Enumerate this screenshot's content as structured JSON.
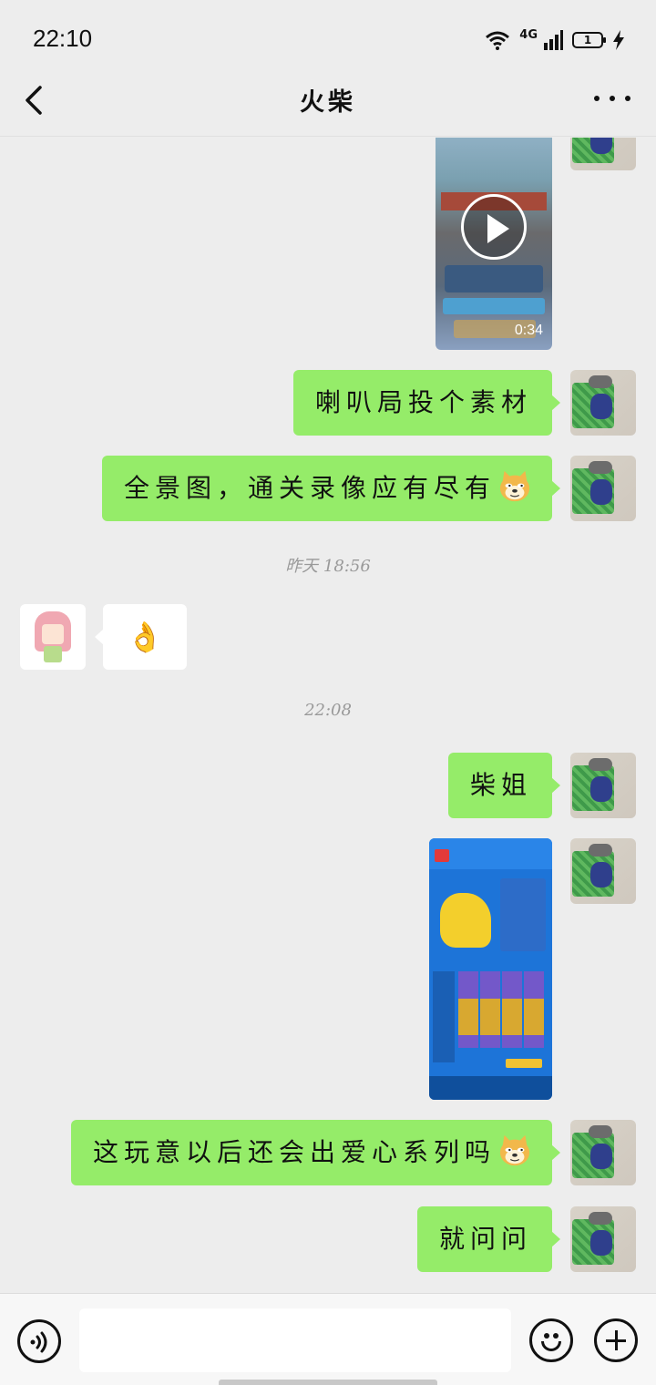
{
  "status_bar": {
    "time": "22:10",
    "network": "4G",
    "battery": "1"
  },
  "header": {
    "title": "火柴",
    "back_icon": "chevron-left-icon",
    "more_icon": "more-dots-icon"
  },
  "messages": [
    {
      "type": "video",
      "sender": "me",
      "duration": "0:34"
    },
    {
      "type": "text",
      "sender": "me",
      "text": "喇叭局投个素材"
    },
    {
      "type": "text",
      "sender": "me",
      "text": "全景图，通关录像应有尽有",
      "emoji": "doge"
    },
    {
      "type": "timestamp",
      "text": "昨天 18:56"
    },
    {
      "type": "text",
      "sender": "friend",
      "text": "👌"
    },
    {
      "type": "timestamp",
      "text": "22:08"
    },
    {
      "type": "text",
      "sender": "me",
      "text": "柴姐"
    },
    {
      "type": "image",
      "sender": "me"
    },
    {
      "type": "text",
      "sender": "me",
      "text": "这玩意以后还会出爱心系列吗",
      "emoji": "doge"
    },
    {
      "type": "text",
      "sender": "me",
      "text": "就问问"
    }
  ],
  "input_bar": {
    "value": "",
    "placeholder": ""
  },
  "colors": {
    "background": "#ededed",
    "my_bubble": "#95ec69",
    "friend_bubble": "#ffffff",
    "input_bar": "#f7f7f7"
  }
}
